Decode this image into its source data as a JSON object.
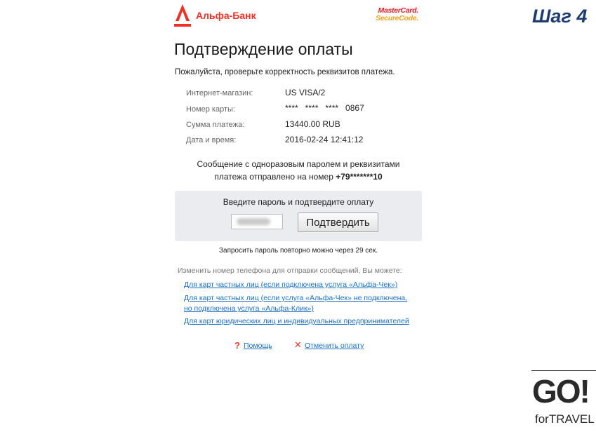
{
  "header": {
    "bank_name": "Альфа-Банк",
    "mastercard_line1": "MasterCard.",
    "mastercard_line2": "SecureCode."
  },
  "step_label": "Шаг 4",
  "page_title": "Подтверждение оплаты",
  "subtitle": "Пожалуйста, проверьте корректность реквизитов платежа.",
  "details": [
    {
      "label": "Интернет-магазин:",
      "value": "US VISA/2"
    },
    {
      "label": "Номер карты:",
      "value": "****   ****   ****   0867"
    },
    {
      "label": "Сумма платежа:",
      "value": "13440.00 RUB"
    },
    {
      "label": "Дата и время:",
      "value": "2016-02-24 12:41:12"
    }
  ],
  "sms_notice": {
    "line1": "Сообщение с одноразовым паролем и реквизитами",
    "line2_prefix": "платежа отправлено на номер ",
    "phone": "+79*******10"
  },
  "otp": {
    "prompt": "Введите пароль и подтвердите оплату",
    "input_value": "",
    "confirm_label": "Подтвердить"
  },
  "resend_info": "Запросить пароль повторно можно через 29 сек.",
  "change_phone": {
    "intro": "Изменить номер телефона для отправки сообщений, Вы можете:",
    "links": [
      "Для карт частных лиц (если подключена услуга «Альфа-Чек»)",
      "Для карт частных лиц (если услуга «Альфа-Чек» не подключена,",
      "но подключена услуга «Альфа-Клик»)",
      "Для карт юридических лиц и индивидуальных предпринимателей"
    ]
  },
  "footer": {
    "help_icon": "?",
    "help_label": "Помощь",
    "cancel_icon": "✕",
    "cancel_label": "Отменить оплату"
  },
  "logo": {
    "go": "GO!",
    "sub": "forTRAVEL"
  },
  "colors": {
    "brand_red": "#ef3124",
    "link_blue": "#1a6fc4",
    "step_blue": "#1e3c6e",
    "panel_gray": "#eaecef"
  }
}
